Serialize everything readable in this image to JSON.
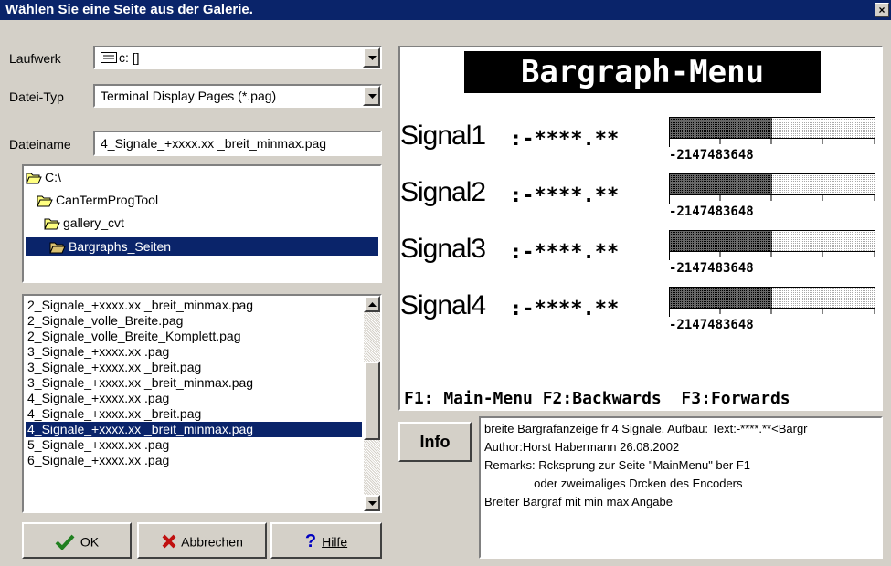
{
  "window": {
    "title": "Wählen Sie eine Seite aus der Galerie.",
    "close": "×"
  },
  "left": {
    "drive_label": "Laufwerk",
    "drive_value": "c: []",
    "filetype_label": "Datei-Typ",
    "filetype_value": "Terminal Display Pages  (*.pag)",
    "filename_label": "Dateiname",
    "filename_value": "4_Signale_+xxxx.xx _breit_minmax.pag",
    "folders": [
      "C:\\",
      "CanTermProgTool",
      "gallery_cvt",
      "Bargraphs_Seiten"
    ],
    "files": [
      "2_Signale_+xxxx.xx _breit_minmax.pag",
      "2_Signale_volle_Breite.pag",
      "2_Signale_volle_Breite_Komplett.pag",
      "3_Signale_+xxxx.xx .pag",
      "3_Signale_+xxxx.xx _breit.pag",
      "3_Signale_+xxxx.xx _breit_minmax.pag",
      "4_Signale_+xxxx.xx .pag",
      "4_Signale_+xxxx.xx _breit.pag",
      "4_Signale_+xxxx.xx _breit_minmax.pag",
      "5_Signale_+xxxx.xx .pag",
      "6_Signale_+xxxx.xx .pag"
    ]
  },
  "buttons": {
    "ok": "OK",
    "cancel": "Abbrechen",
    "help": "Hilfe"
  },
  "preview": {
    "title": "Bargraph-Menu",
    "signals": [
      {
        "label": "Signal1",
        "value": ":-****.**",
        "scale": "-2147483648"
      },
      {
        "label": "Signal2",
        "value": ":-****.**",
        "scale": "-2147483648"
      },
      {
        "label": "Signal3",
        "value": ":-****.**",
        "scale": "-2147483648"
      },
      {
        "label": "Signal4",
        "value": ":-****.**",
        "scale": "-2147483648"
      }
    ],
    "footer": "F1: Main-Menu F2:Backwards  F3:Forwards"
  },
  "info": {
    "button": "Info",
    "lines": [
      "breite Bargrafanzeige fr 4 Signale. Aufbau: Text:-****.**<Bargr",
      "Author:Horst Habermann 26.08.2002",
      "Remarks: Rcksprung zur Seite \"MainMenu\" ber F1",
      "               oder zweimaliges Drcken des Encoders",
      "Breiter Bargraf mit min max Angabe"
    ]
  }
}
